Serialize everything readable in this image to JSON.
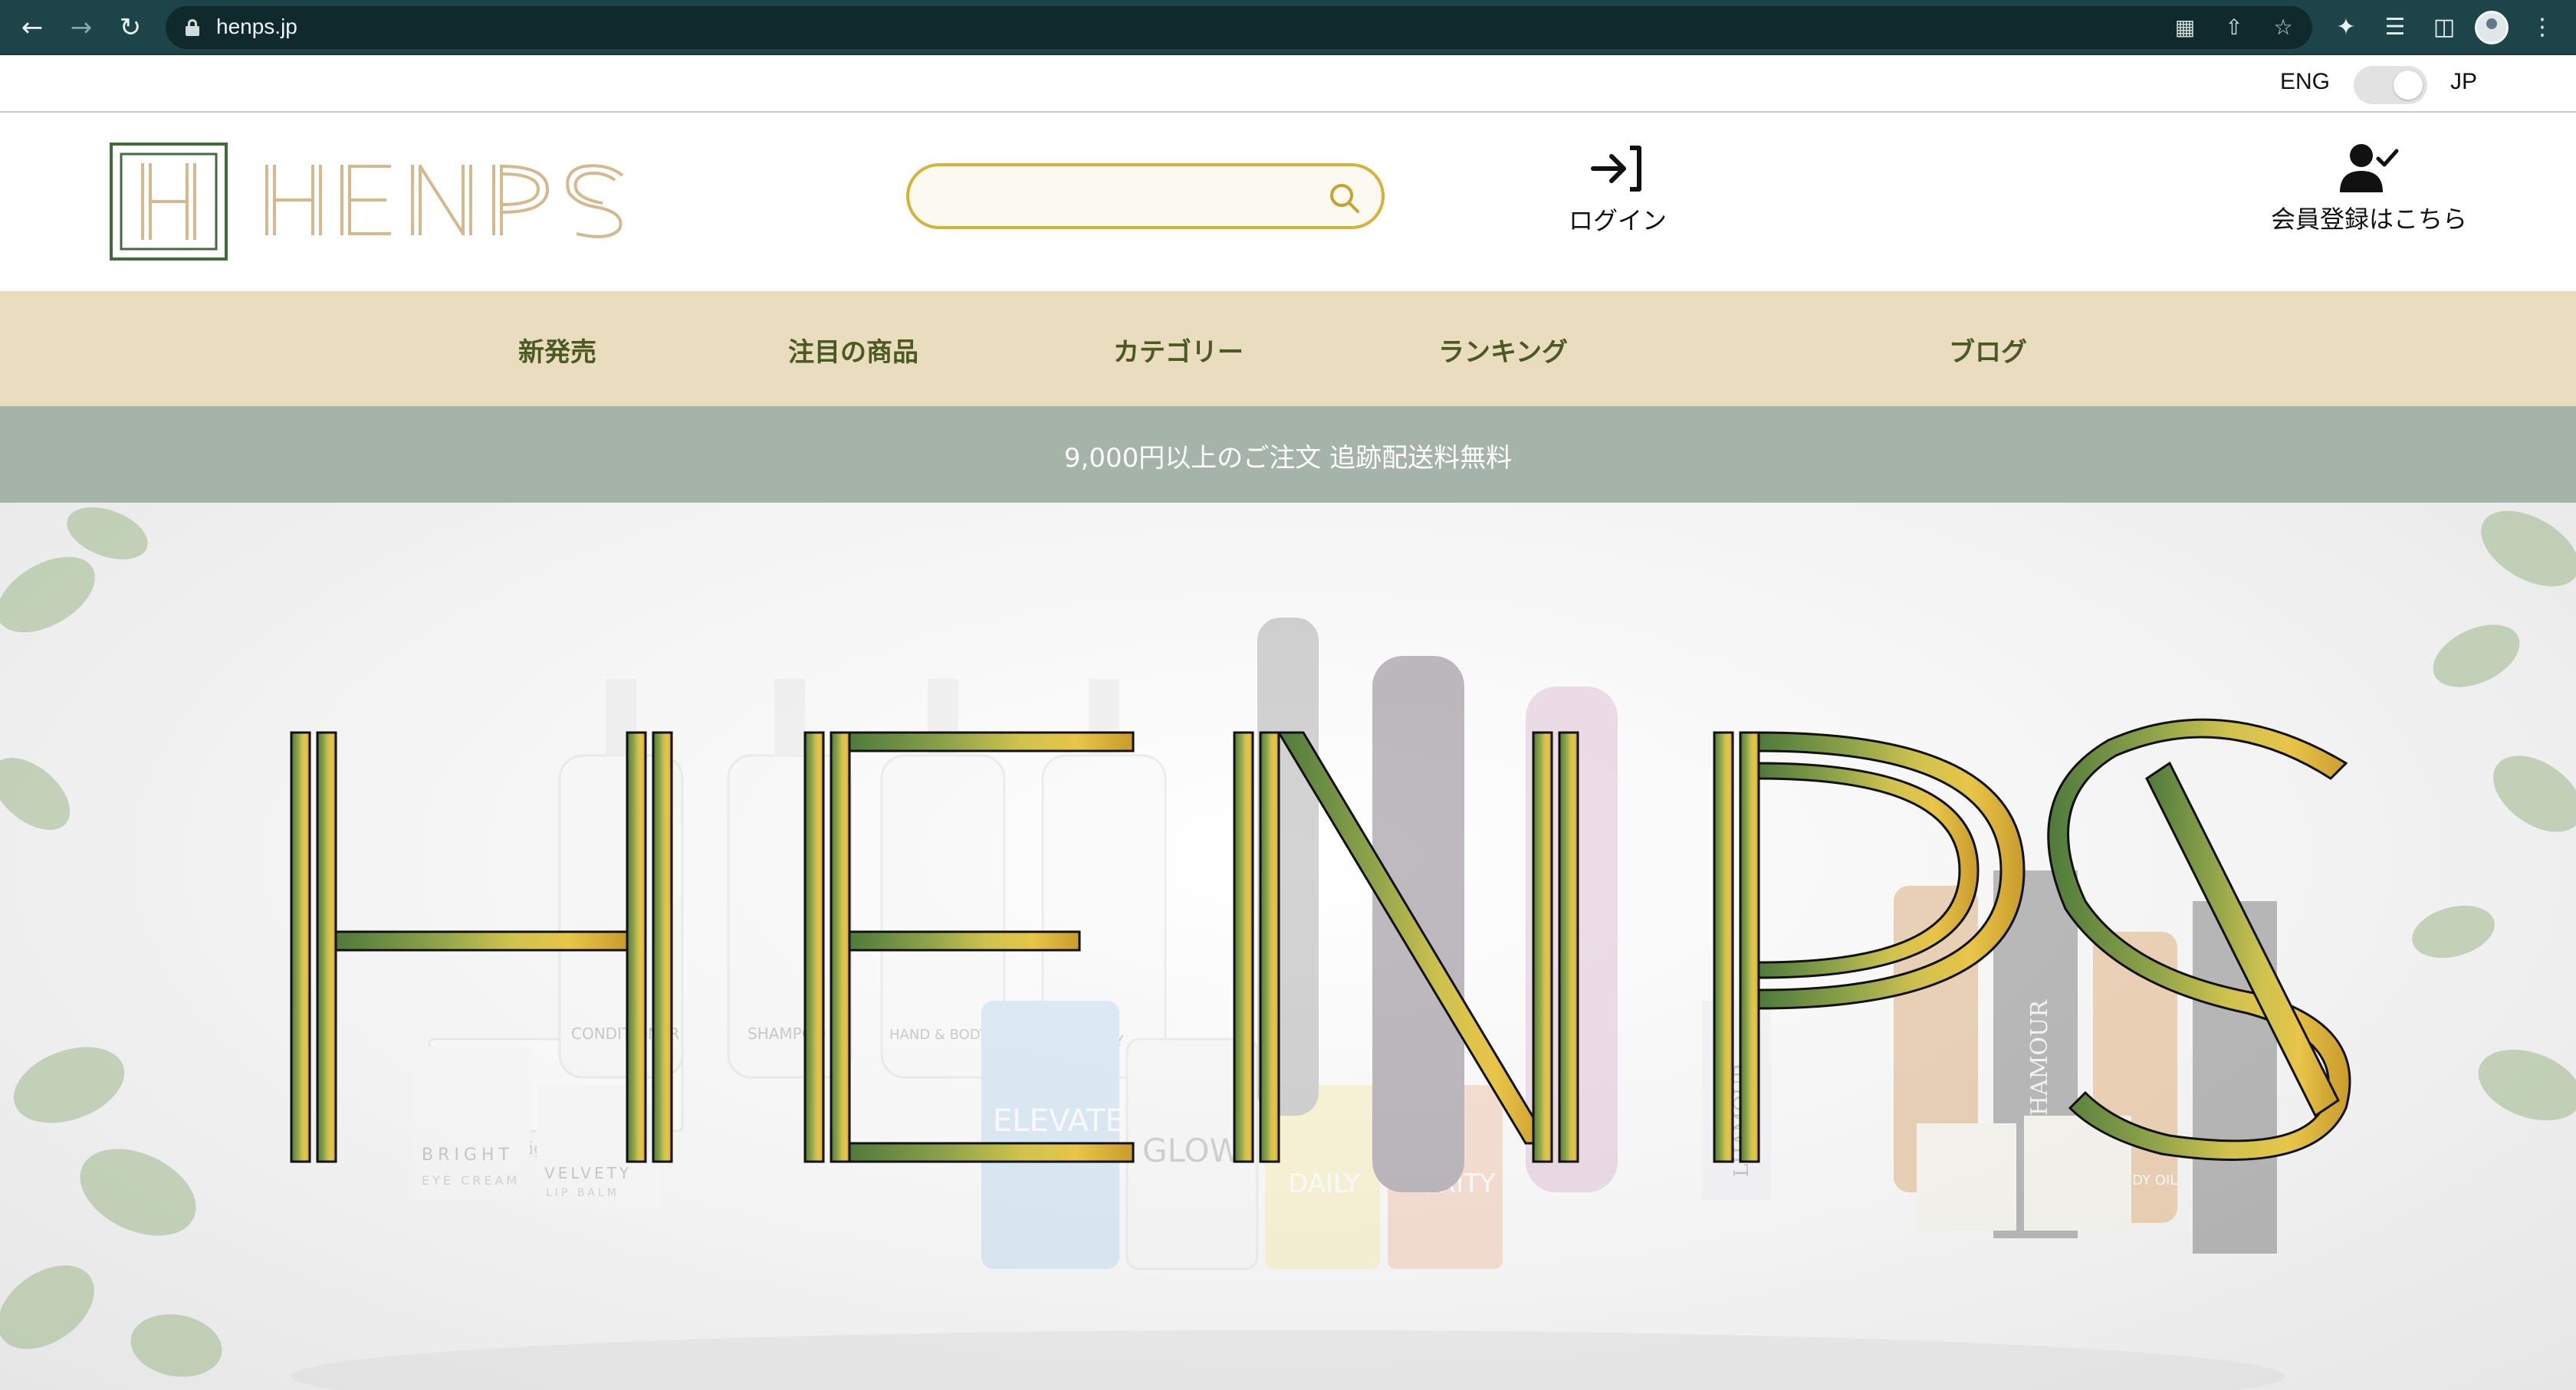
{
  "browser": {
    "url": "henps.jp"
  },
  "language": {
    "left_label": "ENG",
    "right_label": "JP",
    "selected": "JP"
  },
  "header": {
    "brand": "HENPS",
    "search": {
      "value": "",
      "placeholder": ""
    },
    "login_label": "ログイン",
    "register_label": "会員登録はこちら"
  },
  "nav": {
    "items": [
      {
        "label": "新発売"
      },
      {
        "label": "注目の商品"
      },
      {
        "label": "カテゴリー"
      },
      {
        "label": "ランキング"
      },
      {
        "label": "ブログ"
      }
    ]
  },
  "promo": {
    "text": "9,000円以上のご注文 追跡配送料無料"
  },
  "hero": {
    "title": "HENPS",
    "product_labels": [
      "InnerOrigin",
      "CONDITIONER",
      "SHAMPOO",
      "HAND & BODY WASH",
      "BODY",
      "BRIGHT",
      "EYE CREAM",
      "VELVETY",
      "LIP BALM",
      "ELEVATE",
      "GLOW",
      "DAILY",
      "PURITY",
      "LHAMOUR",
      "BODY OIL"
    ]
  },
  "colors": {
    "chrome": "#1d4449",
    "accent_gold": "#d8b137",
    "nav_bg": "#eadcbe",
    "nav_text": "#4a5a22",
    "promo_bg": "#a6b3a9",
    "logo_green": "#3f6b3d",
    "logo_tan": "#d4b98c"
  }
}
